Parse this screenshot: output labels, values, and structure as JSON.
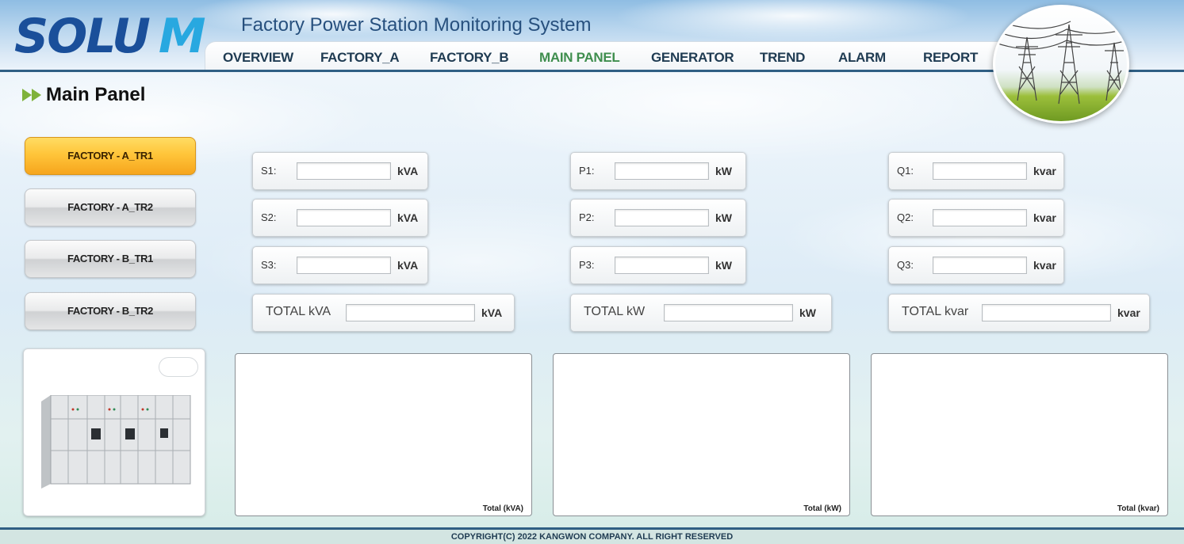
{
  "header": {
    "logo_left": "SOLU",
    "logo_right": "M",
    "title": "Factory Power Station Monitoring System"
  },
  "nav": [
    {
      "label": "OVERVIEW",
      "active": false
    },
    {
      "label": "FACTORY_A",
      "active": false
    },
    {
      "label": "FACTORY_B",
      "active": false
    },
    {
      "label": "MAIN PANEL",
      "active": true
    },
    {
      "label": "GENERATOR",
      "active": false
    },
    {
      "label": "TREND",
      "active": false
    },
    {
      "label": "ALARM",
      "active": false
    },
    {
      "label": "REPORT",
      "active": false
    }
  ],
  "page_title": "Main Panel",
  "transformers": [
    {
      "label": "FACTORY - A_TR1",
      "active": true
    },
    {
      "label": "FACTORY - A_TR2",
      "active": false
    },
    {
      "label": "FACTORY - B_TR1",
      "active": false
    },
    {
      "label": "FACTORY - B_TR2",
      "active": false
    }
  ],
  "apparent": {
    "rows": [
      {
        "label": "S1:",
        "value": "",
        "unit": "kVA"
      },
      {
        "label": "S2:",
        "value": "",
        "unit": "kVA"
      },
      {
        "label": "S3:",
        "value": "",
        "unit": "kVA"
      }
    ],
    "total": {
      "label": "TOTAL kVA",
      "value": "",
      "unit": "kVA"
    },
    "chart_caption": "Total (kVA)"
  },
  "active_power": {
    "rows": [
      {
        "label": "P1:",
        "value": "",
        "unit": "kW"
      },
      {
        "label": "P2:",
        "value": "",
        "unit": "kW"
      },
      {
        "label": "P3:",
        "value": "",
        "unit": "kW"
      }
    ],
    "total": {
      "label": "TOTAL kW",
      "value": "",
      "unit": "kW"
    },
    "chart_caption": "Total (kW)"
  },
  "reactive": {
    "rows": [
      {
        "label": "Q1:",
        "value": "",
        "unit": "kvar"
      },
      {
        "label": "Q2:",
        "value": "",
        "unit": "kvar"
      },
      {
        "label": "Q3:",
        "value": "",
        "unit": "kvar"
      }
    ],
    "total": {
      "label": "TOTAL kvar",
      "value": "",
      "unit": "kvar"
    },
    "chart_caption": "Total (kvar)"
  },
  "footer": "COPYRIGHT(C) 2022 KANGWON COMPANY. ALL RIGHT RESERVED",
  "colors": {
    "accent_active_nav": "#3f8e4e",
    "active_button": "#ffc53a",
    "header_line": "#2f5f84"
  }
}
